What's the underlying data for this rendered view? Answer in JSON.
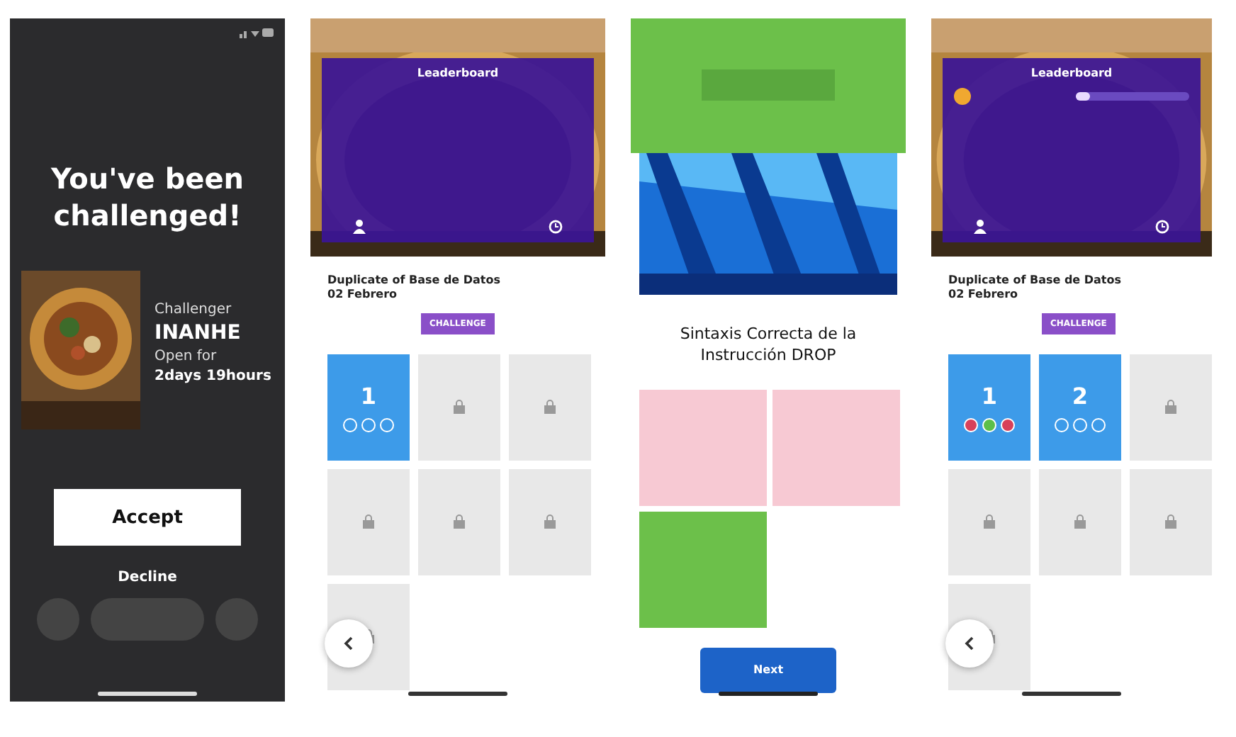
{
  "screens": [
    {
      "kind": "challenge",
      "title": "You've been challenged!",
      "challenger_label": "Challenger",
      "challenger": "INANHE",
      "open_label": "Open for",
      "open_time": "2days 19hours",
      "accept": "Accept",
      "decline": "Decline"
    },
    {
      "kind": "board",
      "leaderboard": "Leaderboard",
      "quiz_title": "Duplicate of Base de Datos",
      "quiz_date": "02 Febrero",
      "chip": "CHALLENGE",
      "tiles": [
        {
          "kind": "played",
          "number": "1",
          "answers": [
            {
              "answered": false
            },
            {
              "answered": false
            },
            {
              "answered": false
            }
          ]
        },
        {
          "kind": "locked"
        },
        {
          "kind": "locked"
        },
        {
          "kind": "locked"
        },
        {
          "kind": "locked"
        },
        {
          "kind": "locked"
        },
        {
          "kind": "locked"
        }
      ]
    },
    {
      "kind": "question",
      "question": "Sintaxis Correcta de la Instrucción DROP",
      "options": [
        {
          "correct": false
        },
        {
          "correct": false
        },
        {
          "correct": true
        }
      ],
      "next": "Next"
    },
    {
      "kind": "board",
      "leaderboard": "Leaderboard",
      "player_progress": {
        "level": 0.12
      },
      "quiz_title": "Duplicate of Base de Datos",
      "quiz_date": "02 Febrero",
      "chip": "CHALLENGE",
      "tiles": [
        {
          "kind": "played",
          "number": "1",
          "answers": [
            {
              "answered": true,
              "color": "#d8405a"
            },
            {
              "answered": true,
              "color": "#5cbf4a"
            },
            {
              "answered": true,
              "color": "#d8405a"
            }
          ]
        },
        {
          "kind": "played",
          "number": "2",
          "answers": [
            {
              "answered": false
            },
            {
              "answered": false
            },
            {
              "answered": false
            }
          ]
        },
        {
          "kind": "locked"
        },
        {
          "kind": "locked"
        },
        {
          "kind": "locked"
        },
        {
          "kind": "locked"
        },
        {
          "kind": "locked"
        }
      ]
    }
  ]
}
